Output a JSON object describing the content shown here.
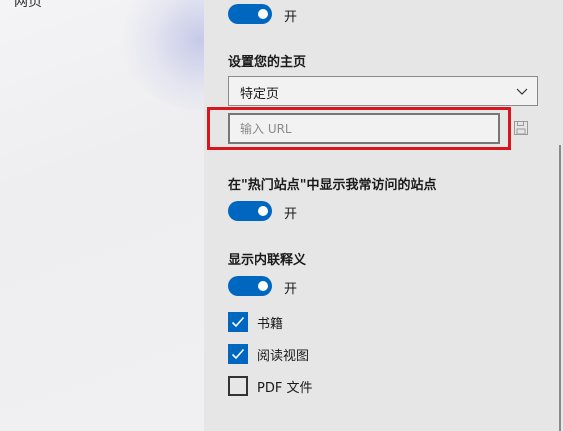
{
  "background": {
    "partial_label": "网页"
  },
  "settings": {
    "open_toggle": {
      "label": "开",
      "on": true
    },
    "homepage": {
      "heading": "设置您的主页",
      "dropdown_selected": "特定页",
      "url_placeholder": "输入 URL",
      "url_value": ""
    },
    "top_sites": {
      "heading": "在\"热门站点\"中显示我常访问的站点",
      "toggle_label": "开",
      "on": true
    },
    "inline_definitions": {
      "heading": "显示内联释义",
      "toggle_label": "开",
      "on": true,
      "options": [
        {
          "label": "书籍",
          "checked": true
        },
        {
          "label": "阅读视图",
          "checked": true
        },
        {
          "label": "PDF 文件",
          "checked": false
        }
      ]
    }
  },
  "colors": {
    "accent": "#0067c0",
    "highlight": "#d9161d",
    "panel_bg": "#e6e6e6"
  },
  "icons": {
    "dropdown": "chevron-down-icon",
    "save": "save-icon",
    "check": "checkmark-icon"
  }
}
